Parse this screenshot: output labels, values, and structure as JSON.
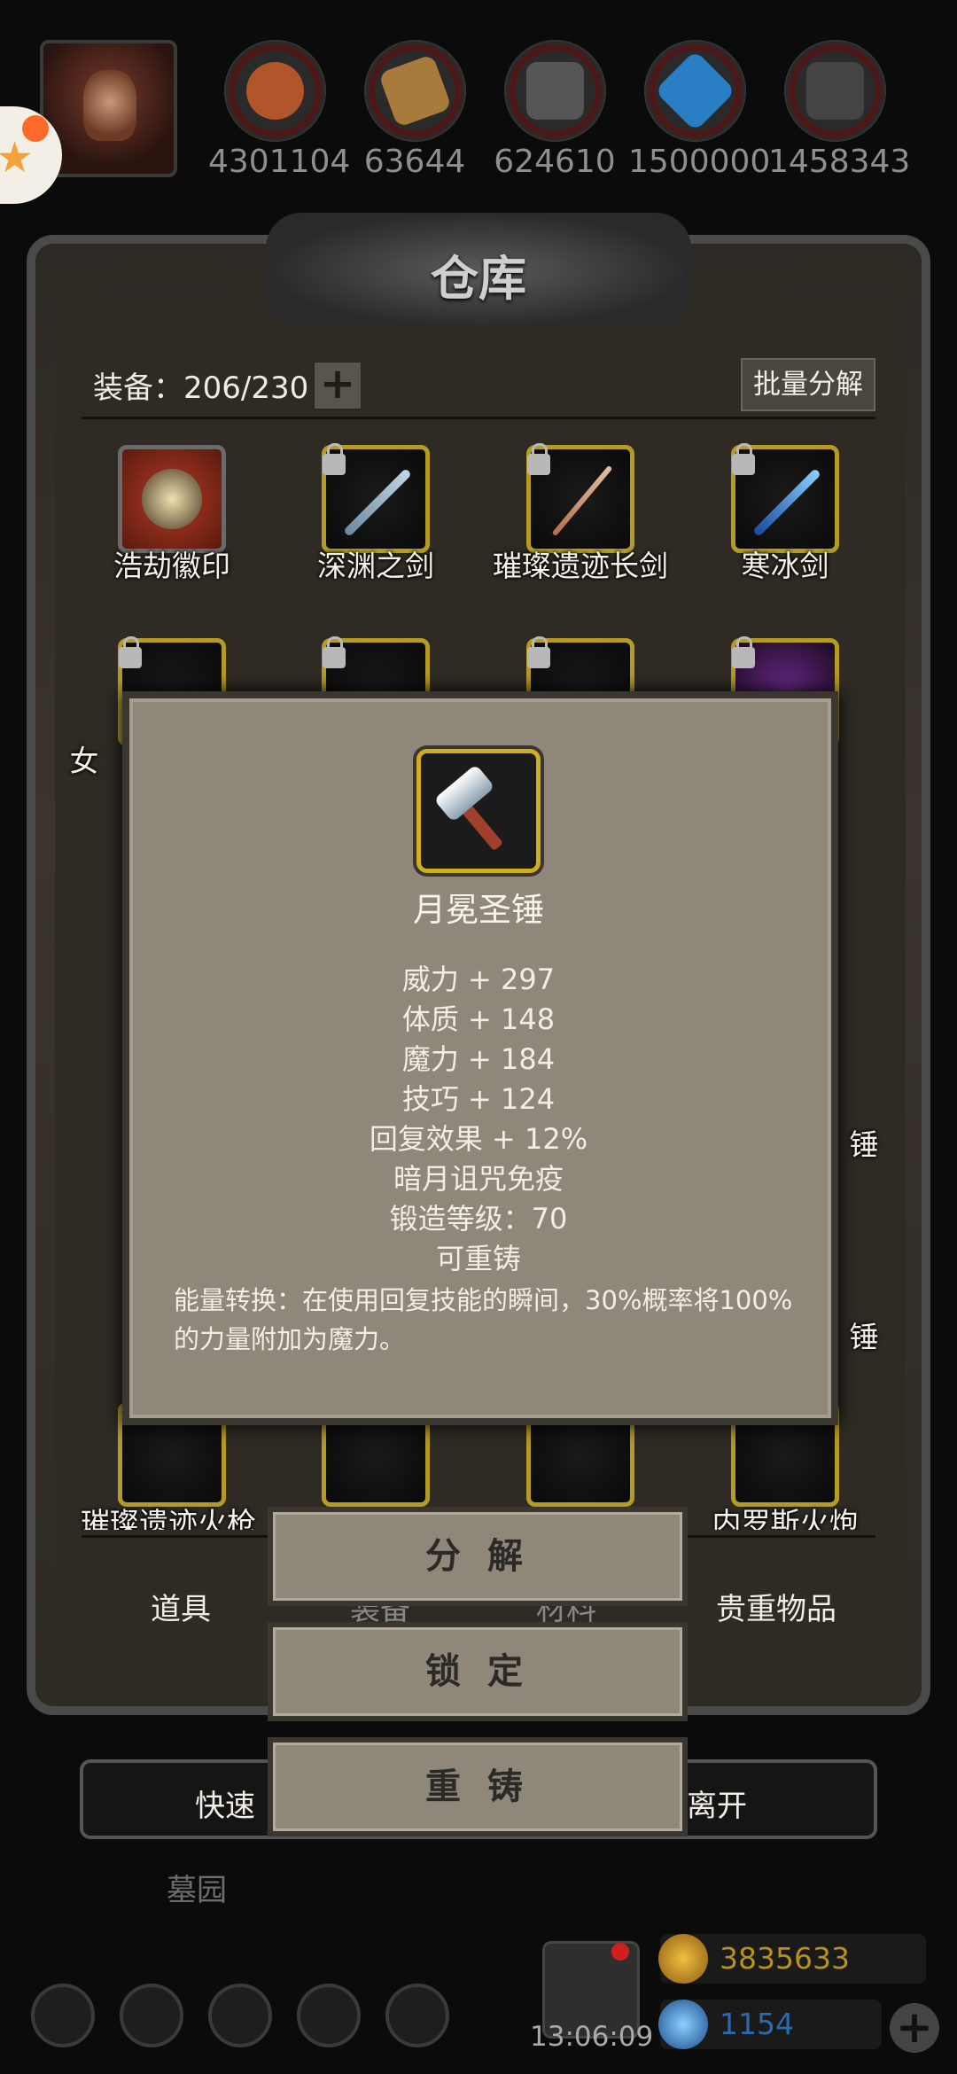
{
  "resources": [
    {
      "name": "meat-icon",
      "value": "4301104",
      "color": "#b1552a"
    },
    {
      "name": "wood-icon",
      "value": "63644",
      "color": "#a87a3c"
    },
    {
      "name": "iron-icon",
      "value": "624610",
      "color": "#555555"
    },
    {
      "name": "crystal-icon",
      "value": "1500000",
      "color": "#2a7fc4"
    },
    {
      "name": "ore-icon",
      "value": "1458343",
      "color": "#444444"
    }
  ],
  "panel": {
    "title": "仓库",
    "equip_label": "装备：206/230",
    "plus": "+",
    "batch_button": "批量分解"
  },
  "items_row1": [
    {
      "name": "浩劫徽印",
      "locked": false
    },
    {
      "name": "深渊之剑",
      "locked": true
    },
    {
      "name": "璀璨遗迹长剑",
      "locked": true
    },
    {
      "name": "寒冰剑",
      "locked": true
    }
  ],
  "partial_labels": {
    "row2_left": "女",
    "row4_right": "锤",
    "row5_right": "锤",
    "row6_left": "璀璨遗迹火枪",
    "row6_right": "内罗斯火炮"
  },
  "tabs": {
    "tab1": "道具",
    "tab2": "装备",
    "tab3": "材料",
    "tab4": "贵重物品"
  },
  "quick": {
    "left": "快速",
    "right": "离开"
  },
  "location": "墓园",
  "clock": "13:06:09",
  "currency": {
    "gold": "3835633",
    "gem": "1154",
    "plus": "+"
  },
  "tooltip": {
    "name": "月冕圣锤",
    "stats": [
      "威力 + 297",
      "体质 + 148",
      "魔力 + 184",
      "技巧 + 124",
      "回复效果 + 12%",
      "暗月诅咒免疫",
      "锻造等级：70",
      "可重铸"
    ],
    "description": "能量转换：在使用回复技能的瞬间，30%概率将100%的力量附加为魔力。"
  },
  "actions": {
    "disassemble": "分 解",
    "lock": "锁 定",
    "reforge": "重 铸"
  }
}
